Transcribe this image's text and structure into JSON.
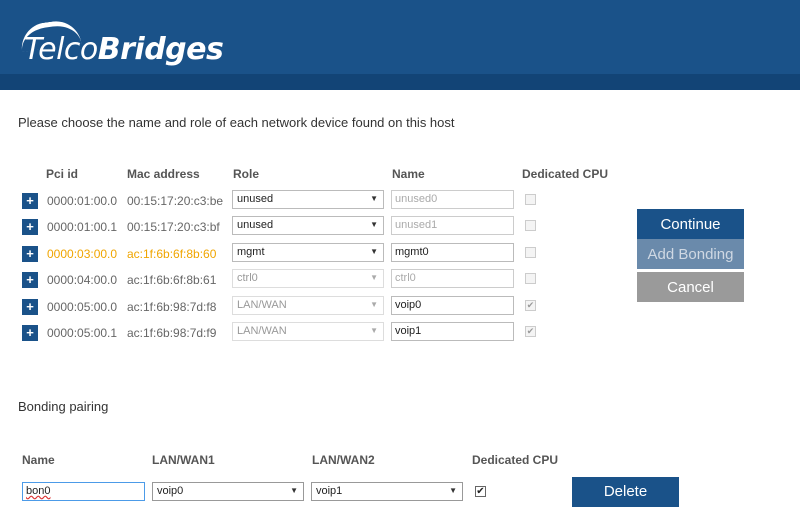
{
  "header": {
    "logo_left": "Telco",
    "logo_right": "Bridges"
  },
  "intro": "Please choose the name and role of each network device found on this host",
  "columns": {
    "pci": "Pci id",
    "mac": "Mac address",
    "role": "Role",
    "name": "Name",
    "cpu": "Dedicated CPU"
  },
  "devices": [
    {
      "pci": "0000:01:00.0",
      "mac": "00:15:17:20:c3:be",
      "role": "unused",
      "name": "unused0",
      "name_disabled": true,
      "role_disabled": false,
      "cpu": false,
      "highlight": false
    },
    {
      "pci": "0000:01:00.1",
      "mac": "00:15:17:20:c3:bf",
      "role": "unused",
      "name": "unused1",
      "name_disabled": true,
      "role_disabled": false,
      "cpu": false,
      "highlight": false
    },
    {
      "pci": "0000:03:00.0",
      "mac": "ac:1f:6b:6f:8b:60",
      "role": "mgmt",
      "name": "mgmt0",
      "name_disabled": false,
      "role_disabled": false,
      "cpu": false,
      "highlight": true
    },
    {
      "pci": "0000:04:00.0",
      "mac": "ac:1f:6b:6f:8b:61",
      "role": "ctrl0",
      "name": "ctrl0",
      "name_disabled": true,
      "role_disabled": true,
      "cpu": false,
      "highlight": false
    },
    {
      "pci": "0000:05:00.0",
      "mac": "ac:1f:6b:98:7d:f8",
      "role": "LAN/WAN",
      "name": "voip0",
      "name_disabled": false,
      "role_disabled": true,
      "cpu": true,
      "highlight": false
    },
    {
      "pci": "0000:05:00.1",
      "mac": "ac:1f:6b:98:7d:f9",
      "role": "LAN/WAN",
      "name": "voip1",
      "name_disabled": false,
      "role_disabled": true,
      "cpu": true,
      "highlight": false
    }
  ],
  "actions": {
    "continue": "Continue",
    "add_bonding": "Add Bonding",
    "cancel": "Cancel"
  },
  "bonding": {
    "title": "Bonding pairing",
    "columns": {
      "name": "Name",
      "lan1": "LAN/WAN1",
      "lan2": "LAN/WAN2",
      "cpu": "Dedicated CPU"
    },
    "name": "bon0",
    "lan1": "voip0",
    "lan2": "voip1",
    "cpu": true,
    "delete": "Delete"
  },
  "glyphs": {
    "plus": "+",
    "arrow": "▼",
    "check": "✔"
  },
  "colors": {
    "brand": "#1a5289",
    "highlight": "#f0a500"
  }
}
